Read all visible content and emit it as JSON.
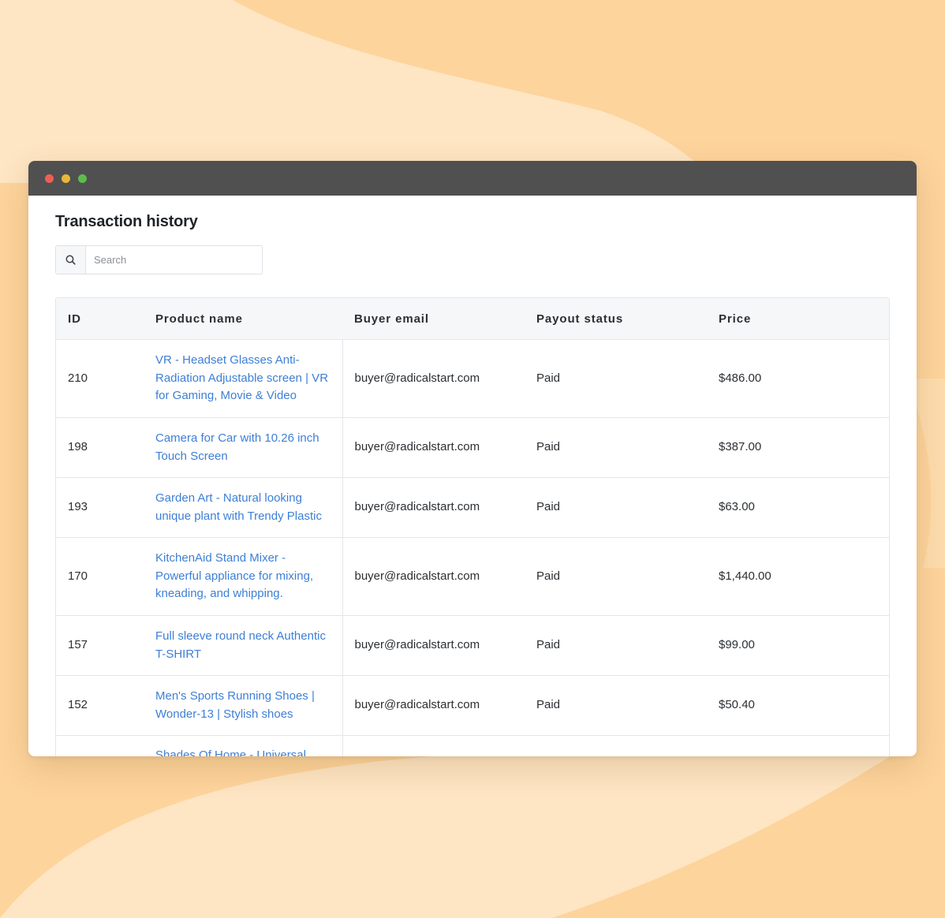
{
  "page": {
    "title": "Transaction history"
  },
  "search": {
    "placeholder": "Search",
    "value": ""
  },
  "table": {
    "columns": [
      "ID",
      "Product name",
      "Buyer email",
      "Payout status",
      "Price"
    ],
    "rows": [
      {
        "id": "210",
        "product": "VR - Headset Glasses Anti-Radiation Adjustable screen | VR for Gaming, Movie & Video",
        "email": "buyer@radicalstart.com",
        "status": "Paid",
        "price": "$486.00"
      },
      {
        "id": "198",
        "product": "Camera for Car with 10.26 inch Touch Screen",
        "email": "buyer@radicalstart.com",
        "status": "Paid",
        "price": "$387.00"
      },
      {
        "id": "193",
        "product": "Garden Art - Natural looking unique plant with Trendy Plastic",
        "email": "buyer@radicalstart.com",
        "status": "Paid",
        "price": "$63.00"
      },
      {
        "id": "170",
        "product": "KitchenAid Stand Mixer - Powerful appliance for mixing, kneading, and whipping.",
        "email": "buyer@radicalstart.com",
        "status": "Paid",
        "price": "$1,440.00"
      },
      {
        "id": "157",
        "product": "Full sleeve round neck Authentic T-SHIRT",
        "email": "buyer@radicalstart.com",
        "status": "Paid",
        "price": "$99.00"
      },
      {
        "id": "152",
        "product": "Men's Sports Running Shoes | Wonder-13 | Stylish shoes",
        "email": "buyer@radicalstart.com",
        "status": "Paid",
        "price": "$50.40"
      },
      {
        "id": "",
        "product": "Shades Of Home - Universal",
        "email": "",
        "status": "",
        "price": ""
      }
    ]
  },
  "colors": {
    "background": "#fdd49c",
    "background_light": "#fee5c3",
    "titlebar": "#505050",
    "link": "#3d7fd6"
  }
}
